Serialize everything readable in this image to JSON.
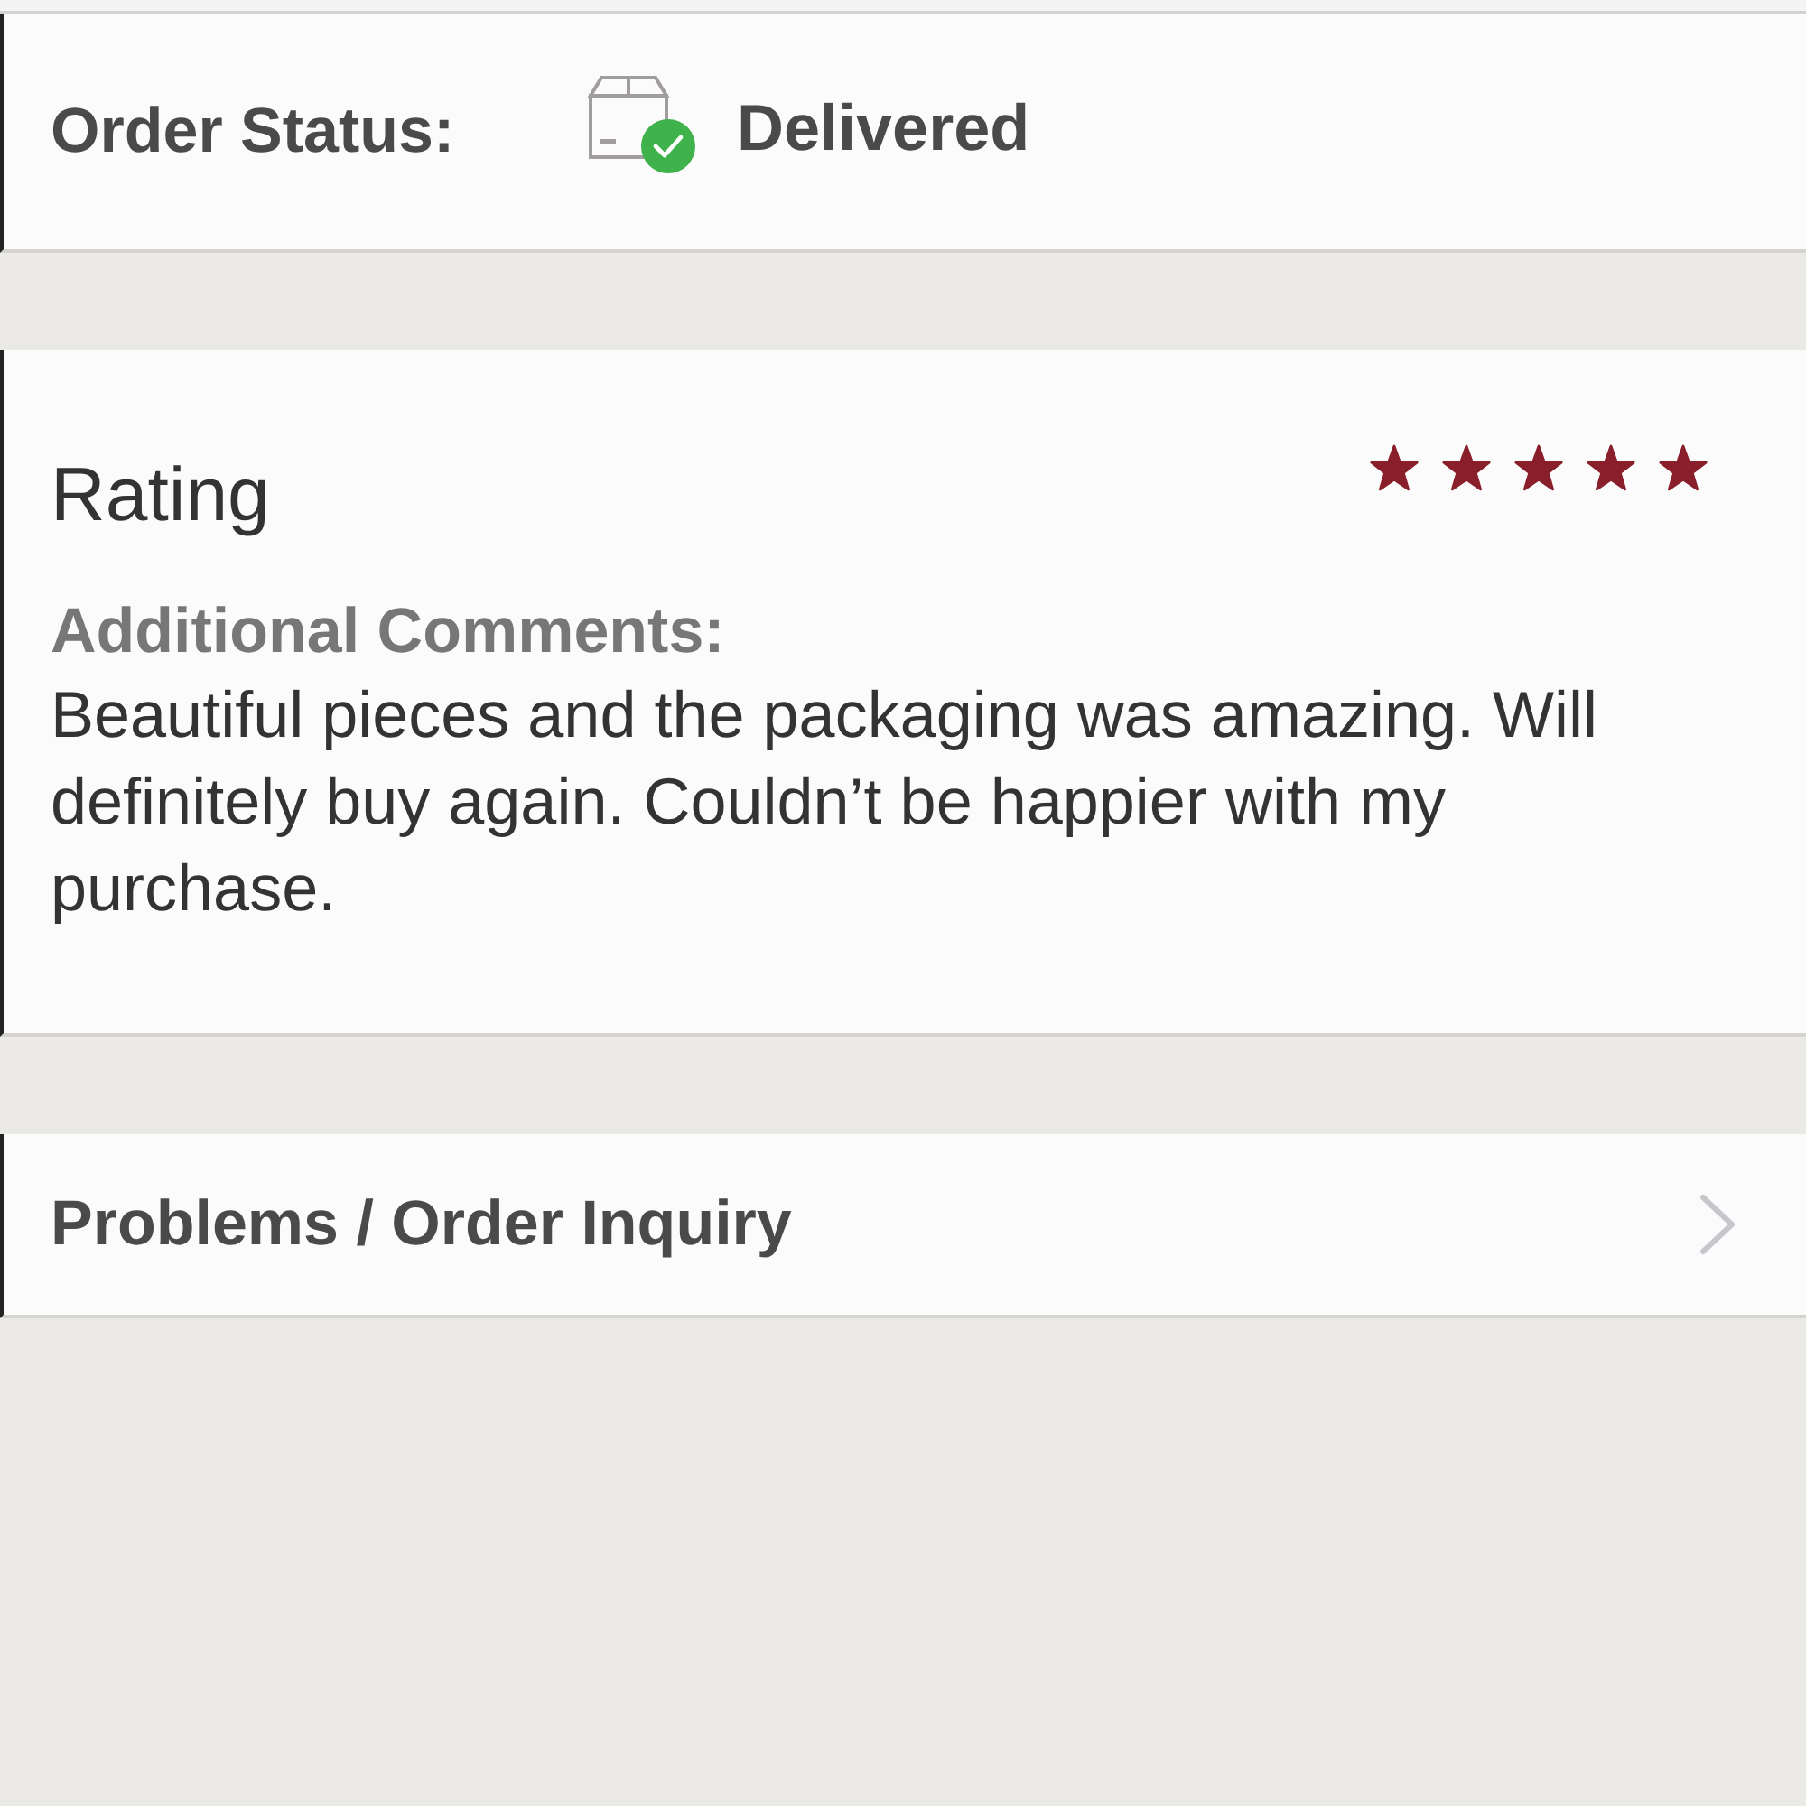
{
  "order_status": {
    "label": "Order Status:",
    "value": "Delivered"
  },
  "rating": {
    "title": "Rating",
    "stars": 5,
    "comments_label": "Additional Comments:",
    "comments": "Beautiful pieces and the packaging was amazing. Will definitely buy again. Couldn’t be happier with my purchase."
  },
  "inquiry_link": {
    "label": "Problems / Order Inquiry"
  }
}
